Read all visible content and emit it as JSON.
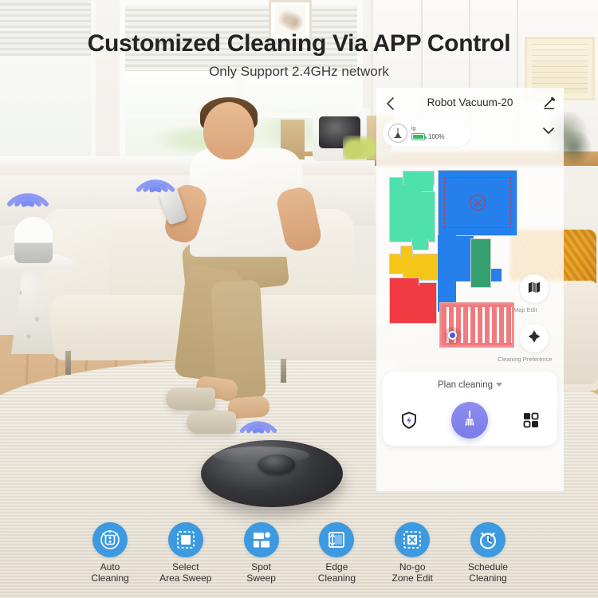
{
  "headline": "Customized Cleaning Via APP Control",
  "subheadline": "Only Support 2.4GHz network",
  "colors": {
    "feature_blue": "#3d9ae0",
    "accent_purple": "#7a7ce8",
    "wifi_blue": "#6f7df0",
    "map_blue": "#2680eb",
    "map_mint": "#4fe0ac",
    "map_yellow": "#f5c518",
    "map_red": "#f03b42",
    "map_green": "#34a06f",
    "map_salmon": "#f08a8d",
    "nogo_red": "#d8323c",
    "battery_green": "#3fb46a"
  },
  "app": {
    "back_icon": "chevron-left-icon",
    "title": "Robot Vacuum-20",
    "edit_icon": "pencil-edit-icon",
    "collapse_icon": "chevron-down-icon",
    "status": {
      "device_icon": "robot-vacuum-icon",
      "device_label": "ig",
      "battery_icon": "battery-full-icon",
      "battery_level": "100%"
    },
    "map": {
      "nogo_icon": "no-go-zone-x-icon",
      "robot_marker": "robot-position-dot",
      "rooms": [
        {
          "name": "room-mint",
          "color": "#4fe0ac"
        },
        {
          "name": "room-blue",
          "color": "#2680eb"
        },
        {
          "name": "room-yellow",
          "color": "#f5c518"
        },
        {
          "name": "room-red",
          "color": "#f03b42"
        },
        {
          "name": "room-green",
          "color": "#34a06f"
        },
        {
          "name": "room-salmon",
          "color": "#f08a8d"
        }
      ],
      "side_buttons": [
        {
          "icon": "map-edit-icon",
          "label": "Map Edit"
        },
        {
          "icon": "cleaning-preference-icon",
          "label": "Cleaning Preference"
        }
      ]
    },
    "controls": {
      "mode_label": "Plan cleaning",
      "mode_caret": "caret-down-icon",
      "left_icon": "shield-charge-icon",
      "main_icon": "broom-clean-icon",
      "right_icon": "room-grid-icon"
    }
  },
  "features": [
    {
      "icon": "auto-cleaning-icon",
      "label": "Auto\nCleaning"
    },
    {
      "icon": "select-area-sweep-icon",
      "label": "Select\nArea Sweep"
    },
    {
      "icon": "spot-sweep-icon",
      "label": "Spot\nSweep"
    },
    {
      "icon": "edge-cleaning-icon",
      "label": "Edge\nCleaning"
    },
    {
      "icon": "no-go-zone-edit-icon",
      "label": "No-go\nZone Edit"
    },
    {
      "icon": "schedule-cleaning-icon",
      "label": "Schedule\nCleaning"
    }
  ],
  "scene": {
    "wifi_badges": [
      "wifi-signal-icon",
      "wifi-signal-icon",
      "wifi-signal-icon"
    ],
    "device": "robot-vacuum-photo"
  }
}
